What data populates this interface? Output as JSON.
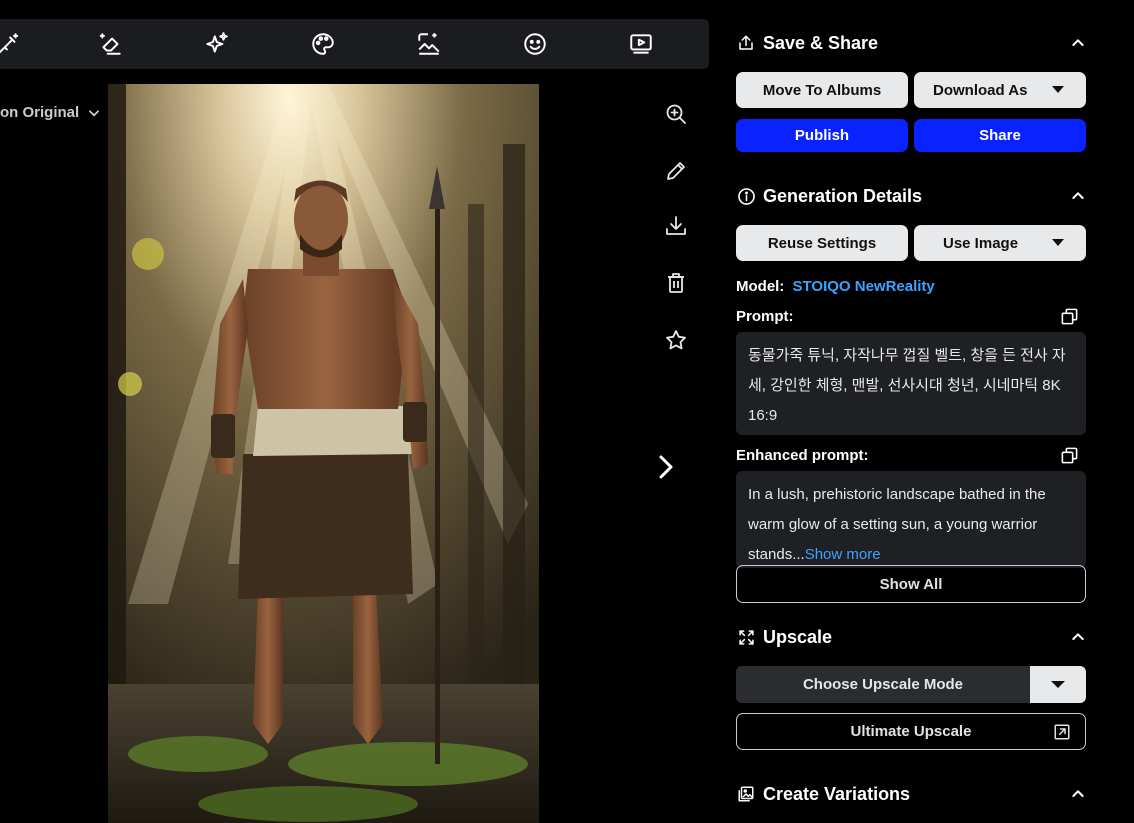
{
  "toolbar": {
    "tools": [
      {
        "icon": "magic-wand-edit-icon"
      },
      {
        "icon": "eraser-icon"
      },
      {
        "icon": "sparkles-icon"
      },
      {
        "icon": "palette-icon"
      },
      {
        "icon": "image-enhance-icon"
      },
      {
        "icon": "smiley-face-icon"
      },
      {
        "icon": "video-play-icon"
      }
    ]
  },
  "compare": {
    "label": "on Original"
  },
  "side_tools": [
    {
      "icon": "zoom-in-icon"
    },
    {
      "icon": "pencil-icon"
    },
    {
      "icon": "download-icon"
    },
    {
      "icon": "trash-icon"
    },
    {
      "icon": "star-icon"
    }
  ],
  "panel": {
    "save_share": {
      "title": "Save & Share",
      "move_to_albums": "Move To Albums",
      "download_as": "Download As",
      "publish": "Publish",
      "share": "Share"
    },
    "generation_details": {
      "title": "Generation Details",
      "reuse_settings": "Reuse Settings",
      "use_image": "Use Image",
      "model_label": "Model:",
      "model_name": "STOIQO NewReality",
      "prompt_label": "Prompt:",
      "prompt_text": "동물가죽 튜닉, 자작나무 껍질 벨트, 창을 든 전사 자세, 강인한 체형, 맨발, 선사시대 청년, 시네마틱 8K 16:9",
      "enhanced_label": "Enhanced prompt:",
      "enhanced_text": "In a lush, prehistoric landscape bathed in the warm glow of a setting sun, a young warrior stands...",
      "show_more": "Show more",
      "show_all": "Show All"
    },
    "upscale": {
      "title": "Upscale",
      "choose_mode": "Choose Upscale Mode",
      "ultimate": "Ultimate Upscale"
    },
    "variations": {
      "title": "Create Variations"
    }
  },
  "colors": {
    "accent_blue": "#0a22ff",
    "link_blue": "#3fa1ff",
    "toolbar_bg": "#1b1c1f",
    "textbox_bg": "#1f2023"
  }
}
